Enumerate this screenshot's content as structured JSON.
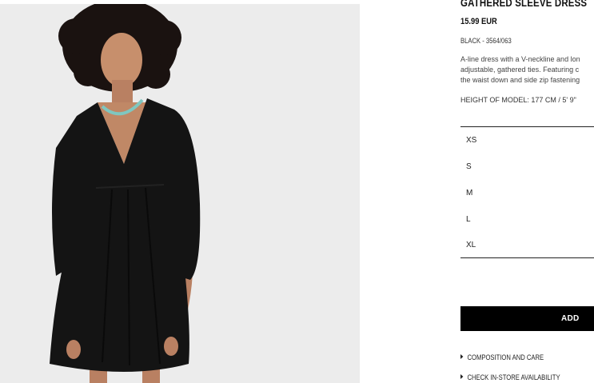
{
  "product": {
    "title": "GATHERED SLEEVE DRESS",
    "price": "15.99 EUR",
    "color_ref": "BLACK - 3564/063",
    "description": "A-line dress with a V-neckline and lon\nadjustable, gathered ties. Featuring c\nthe waist down and side zip fastening",
    "model_height": "HEIGHT OF MODEL: 177 CM / 5' 9\""
  },
  "sizes": [
    "XS",
    "S",
    "M",
    "L",
    "XL"
  ],
  "actions": {
    "add_label": "ADD"
  },
  "links": {
    "composition": "COMPOSITION AND CARE",
    "store": "CHECK IN-STORE AVAILABILITY"
  },
  "colors": {
    "photo_background": "#ececec",
    "dress": "#141414",
    "necklace": "#7fc7c0",
    "button": "#000000"
  }
}
